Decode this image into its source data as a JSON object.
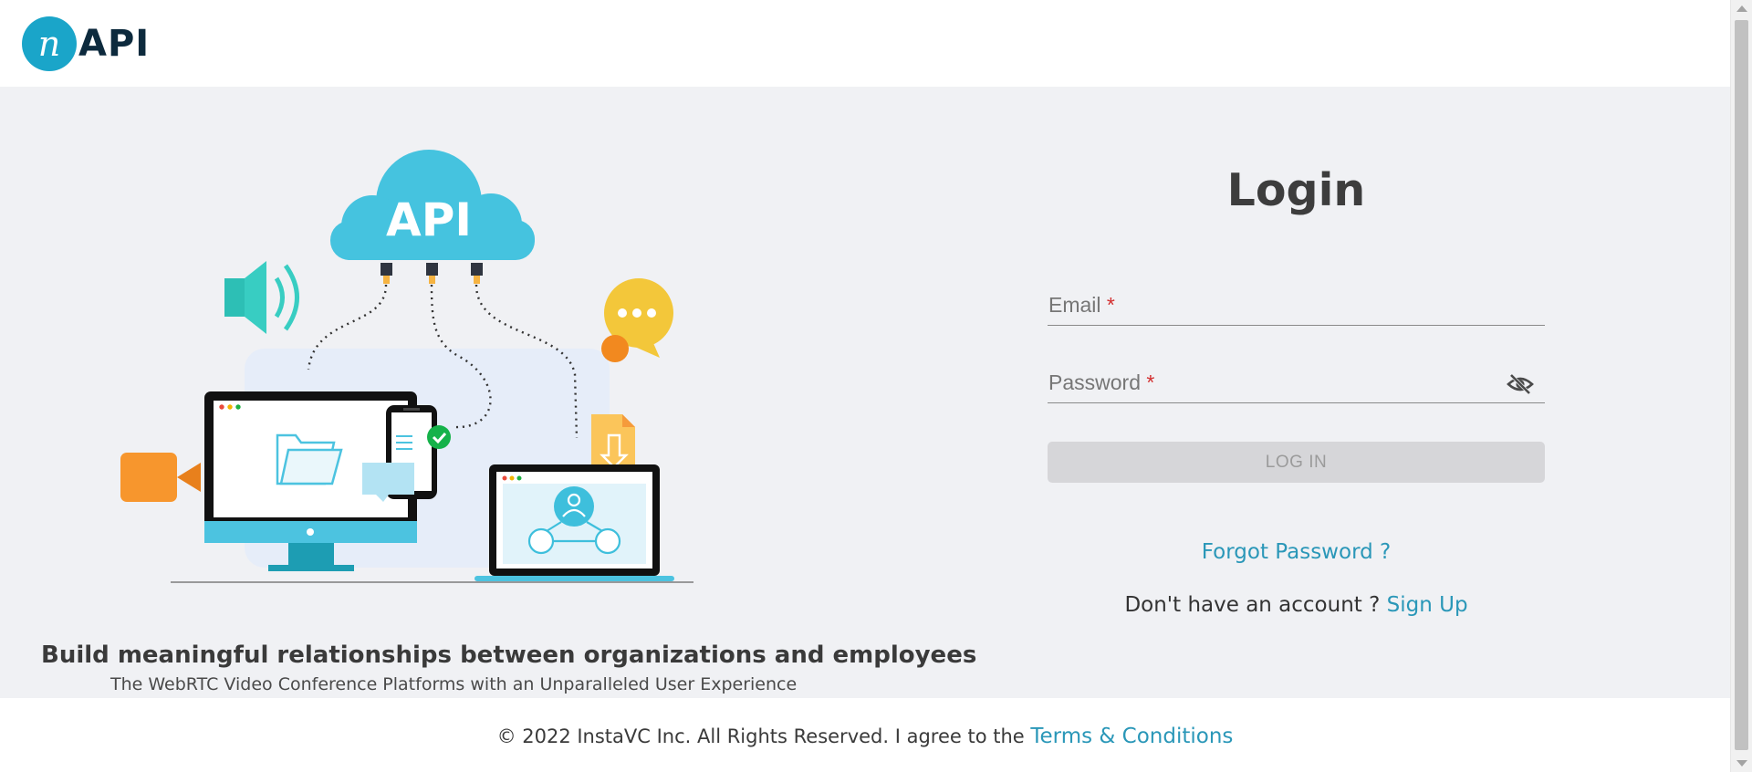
{
  "brand": {
    "logo_letter": "n",
    "logo_text": "API",
    "accent_color": "#1aa5c9",
    "link_color": "#2a97b8"
  },
  "hero": {
    "illustration_text": "API",
    "tagline": "Build meaningful relationships between organizations and employees",
    "subline": "The WebRTC Video Conference Platforms with an Unparalleled User Experience"
  },
  "login": {
    "title": "Login",
    "email_label": "Email",
    "password_label": "Password",
    "required_mark": "*",
    "submit_label": "LOG IN",
    "forgot_label": "Forgot Password ?",
    "signup_prompt": "Don't have an account ?",
    "signup_label": "Sign Up",
    "password_toggle_icon": "eye-off-icon"
  },
  "footer": {
    "copyright": "© 2022 InstaVC Inc. All Rights Reserved. I agree to the",
    "terms_label": "Terms & Conditions"
  }
}
